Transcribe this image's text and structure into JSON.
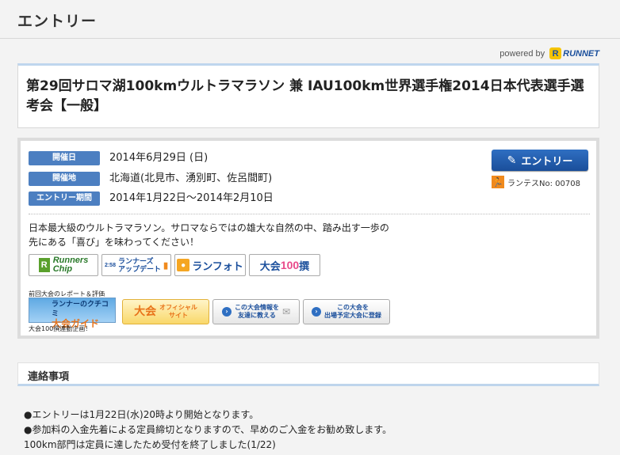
{
  "page": {
    "heading": "エントリー"
  },
  "powered": {
    "text": "powered by",
    "brand": "RUNNET",
    "mark": "R"
  },
  "event": {
    "title": "第29回サロマ湖100kmウルトラマラソン 兼 IAU100km世界選手権2014日本代表選手選考会【一般】"
  },
  "info": {
    "date_label": "開催日",
    "date_value": "2014年6月29日 (日)",
    "place_label": "開催地",
    "place_value": "北海道(北見市、湧別町、佐呂間町)",
    "period_label": "エントリー期間",
    "period_value": "2014年1月22日〜2014年2月10日"
  },
  "entry_button": {
    "label": "エントリー"
  },
  "runtes": {
    "label": "ランテスNo: 00708"
  },
  "description": {
    "line1": "日本最大級のウルトラマラソン。サロマならではの雄大な自然の中、踏み出す一歩の",
    "line2": "先にある「喜び」を味わってください！"
  },
  "banners": {
    "runners_chip_1": "Runners",
    "runners_chip_2": "Chip",
    "runners_update_1": "ランナーズ",
    "runners_update_2": "アップデート",
    "runners_update_sub": "2:58",
    "runphoto": "ランフォト",
    "taikai100": "大会",
    "taikai100_num": "100",
    "taikai100_suffix": "撰"
  },
  "report": {
    "note": "前回大会のレポート＆評価",
    "kuchikomi_1": "ランナーのクチコミ",
    "kuchikomi_2": "大会ガイド",
    "event100_note": "大会100撰連動企画！"
  },
  "action_buttons": {
    "official_1": "大会",
    "official_2": "オフィシャル",
    "official_3": "サイト",
    "tell_friend_1": "この大会情報を",
    "tell_friend_2": "友達に教える",
    "register_1": "この大会を",
    "register_2": "出場予定大会に登録"
  },
  "contact": {
    "heading": "連絡事項",
    "line1": "●エントリーは1月22日(水)20時より開始となります。",
    "line2": "●参加料の入金先着による定員締切となりますので、早めのご入金をお勧め致します。",
    "line3": "100km部門は定員に達したため受付を終了しました(1/22)"
  },
  "colors": {
    "label_blue": "#4c7fc1",
    "entry_blue": "#1a4e9a",
    "runtes_orange": "#f08a1d"
  }
}
